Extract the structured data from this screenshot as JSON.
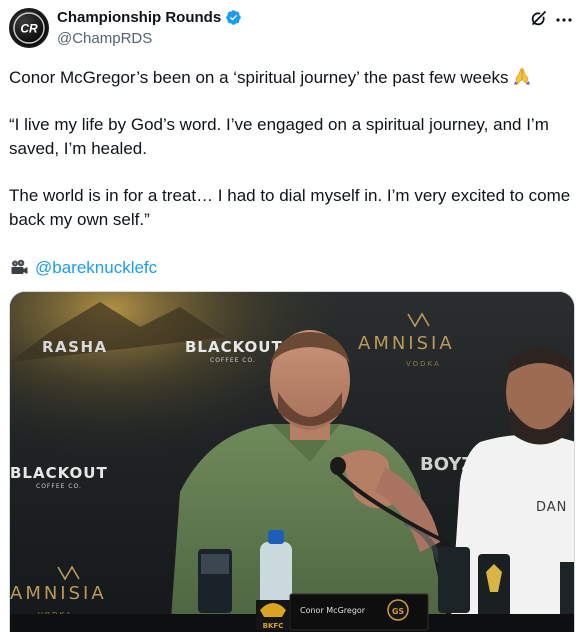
{
  "author": {
    "display_name": "Championship Rounds",
    "handle": "@ChampRDS",
    "avatar_text": "CR",
    "verified": true
  },
  "actions": {
    "grok_icon": "grok-icon",
    "more_icon": "more-icon"
  },
  "tweet": {
    "line1": "Conor McGregor’s been on a ‘spiritual journey’ the past few weeks",
    "line1_emoji": "folded-hands-emoji",
    "paragraph2": "“I live my life by God’s word. I’ve engaged on a spiritual journey, and I’m saved, I’m healed.",
    "paragraph3": "The world is in for a treat… I had to dial myself in. I’m very excited to come back my own self.”",
    "credit_icon": "movie-camera-icon",
    "mention": "@bareknucklefc"
  },
  "media": {
    "banner_rasha": "RASHA",
    "banner_blackout": "BLACKOUT",
    "banner_blackout_sub": "COFFEE CO.",
    "banner_amnisia": "AMNISIA",
    "banner_amnisia_sub": "VODKA",
    "banner_boyz": "BOYZ",
    "shirt_text": "DAN",
    "nameplate": "Conor McGregor",
    "logo_bkfc": "BKFC",
    "logo_gs": "GS"
  },
  "colors": {
    "link": "#1d9bf0",
    "verified": "#1d9bf0",
    "secondary_text": "#536471"
  }
}
